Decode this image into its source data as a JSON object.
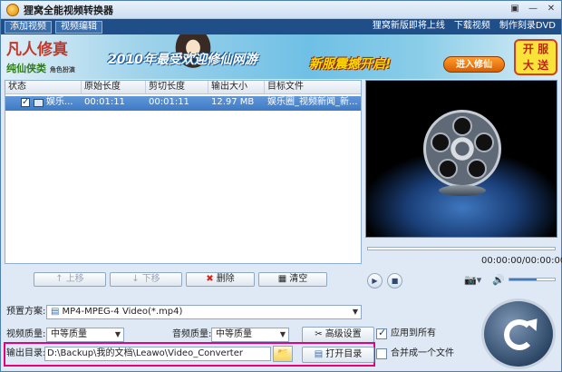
{
  "window": {
    "title": "狸窝全能视频转换器",
    "icon": "app-logo-icon"
  },
  "menubar": {
    "add_video": "添加视频",
    "edit_video": "视频编辑",
    "links": [
      "狸窝新版即将上线",
      "下载视频",
      "制作刻录DVD"
    ]
  },
  "banner": {
    "logo_top_1": "凡人",
    "logo_top_2": "修真",
    "logo_bottom": "纯仙侠类",
    "logo_bottom_small": "角色扮演",
    "headline": "2010年最受欢迎修仙网游",
    "headline2": "新服震撼开启!",
    "cta": "进入修仙",
    "badge": "开 服 大 送"
  },
  "file_list": {
    "columns": [
      "状态",
      "原始长度",
      "剪切长度",
      "输出大小",
      "目标文件"
    ],
    "rows": [
      {
        "checked": true,
        "name": "娱乐...",
        "original": "00:01:11",
        "cut": "00:01:11",
        "size": "12.97 MB",
        "target": "娱乐圈_视频新闻_新..."
      }
    ]
  },
  "list_buttons": {
    "up": "上移",
    "down": "下移",
    "delete": "删除",
    "clear": "清空"
  },
  "player": {
    "time": "00:00:00/00:00:00",
    "volume_fraction": 0.6
  },
  "settings": {
    "preset_label": "预置方案:",
    "preset_value": "MP4-MPEG-4 Video(*.mp4)",
    "video_quality_label": "视频质量:",
    "video_quality_value": "中等质量",
    "audio_quality_label": "音频质量:",
    "audio_quality_value": "中等质量",
    "advanced_button": "高级设置",
    "apply_all_label": "应用到所有",
    "apply_all_checked": true,
    "output_label": "输出目录:",
    "output_path": "D:\\Backup\\我的文档\\Leawo\\Video_Converter",
    "open_folder_button": "打开目录",
    "merge_label": "合并成一个文件",
    "merge_checked": false
  },
  "colors": {
    "menubar": "#1f4e89",
    "selection": "#4a86cc",
    "output_highlight": "#e6007e"
  }
}
